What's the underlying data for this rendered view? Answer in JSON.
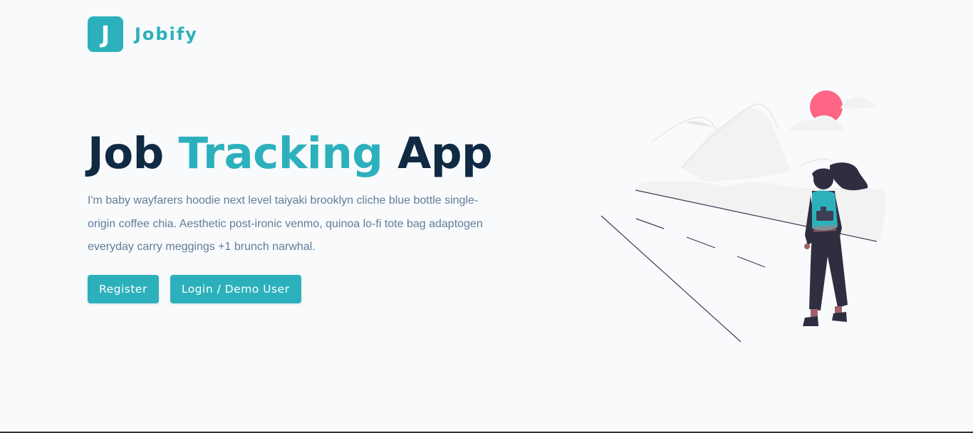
{
  "brand": {
    "logo_letter": "J",
    "name": "Jobify",
    "color": "#2cb1bc"
  },
  "hero": {
    "title_part1": "Job",
    "title_accent": "Tracking",
    "title_part2": "App",
    "description": "I'm baby wayfarers hoodie next level taiyaki brooklyn cliche blue bottle single-origin coffee chia. Aesthetic post-ironic venmo, quinoa lo-fi tote bag adaptogen everyday carry meggings +1 brunch narwhal.",
    "register_label": "Register",
    "login_label": "Login / Demo User"
  },
  "colors": {
    "background": "#f8fafc",
    "primary": "#2cb1bc",
    "heading": "#102a43",
    "text": "#627d98",
    "sun": "#ff6584",
    "figure_dark": "#2f2e41"
  },
  "icons": {
    "logo": "letter-j-logo",
    "illustration": "woman-hiking-illustration"
  }
}
